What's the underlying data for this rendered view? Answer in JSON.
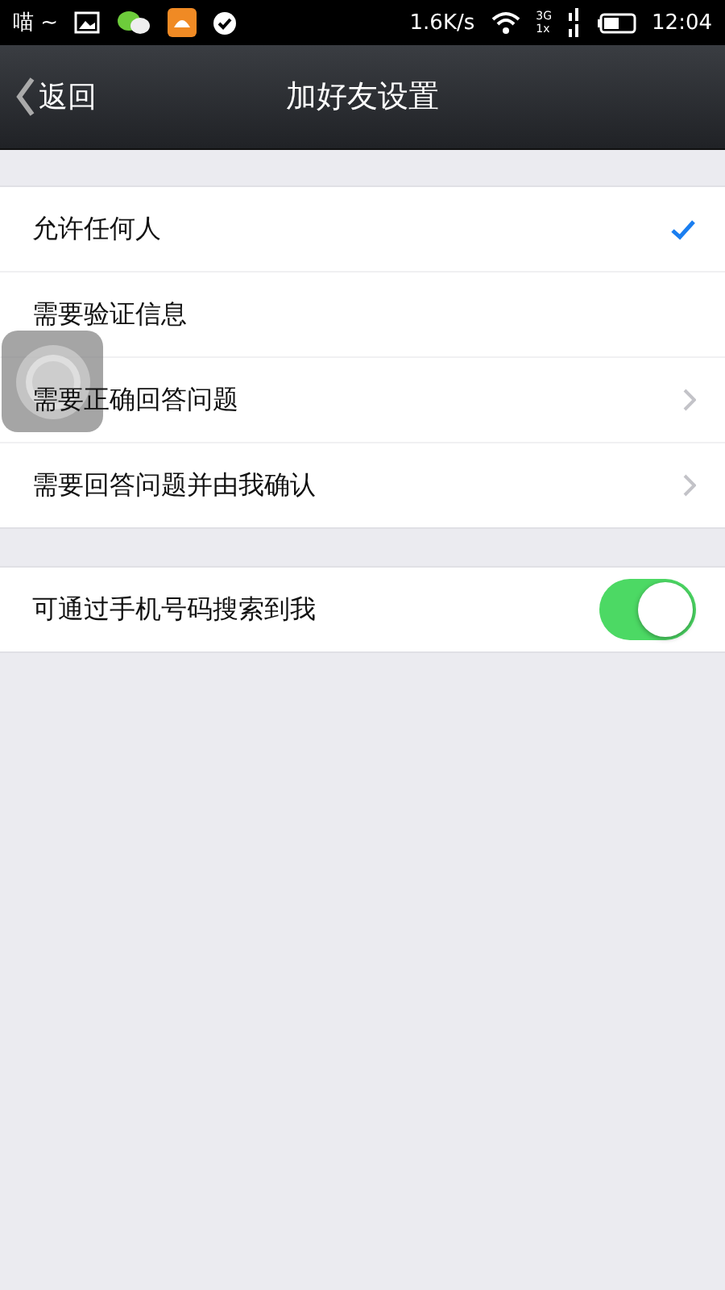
{
  "status_bar": {
    "carrier": "喵 ~",
    "speed": "1.6K/s",
    "network_top": "3G",
    "network_bottom": "1x",
    "time": "12:04"
  },
  "nav_bar": {
    "back": "返回",
    "title": "加好友设置"
  },
  "options": [
    {
      "label": "允许任何人",
      "kind": "choice",
      "selected": true
    },
    {
      "label": "需要验证信息",
      "kind": "choice",
      "selected": false
    },
    {
      "label": "需要正确回答问题",
      "kind": "link",
      "selected": false
    },
    {
      "label": "需要回答问题并由我确认",
      "kind": "link",
      "selected": false
    }
  ],
  "search_setting": {
    "label": "可通过手机号码搜索到我",
    "on": true
  },
  "floating_button": {
    "kind": "assistive"
  }
}
